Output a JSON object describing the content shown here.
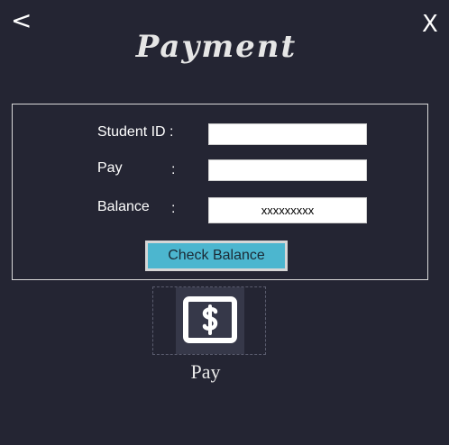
{
  "nav": {
    "back_label": "<",
    "close_label": "X"
  },
  "header": {
    "title": "Payment"
  },
  "form": {
    "student_id_label": "Student ID :",
    "pay_label": "Pay",
    "pay_colon": ":",
    "balance_label": "Balance",
    "balance_colon": ":",
    "student_id_value": "",
    "pay_value": "",
    "balance_value": "xxxxxxxxx",
    "check_balance_label": "Check Balance"
  },
  "pay_tile": {
    "icon": "dollar-icon",
    "label": "Pay"
  },
  "colors": {
    "background": "#242533",
    "button_accent": "#4cb6cf"
  }
}
